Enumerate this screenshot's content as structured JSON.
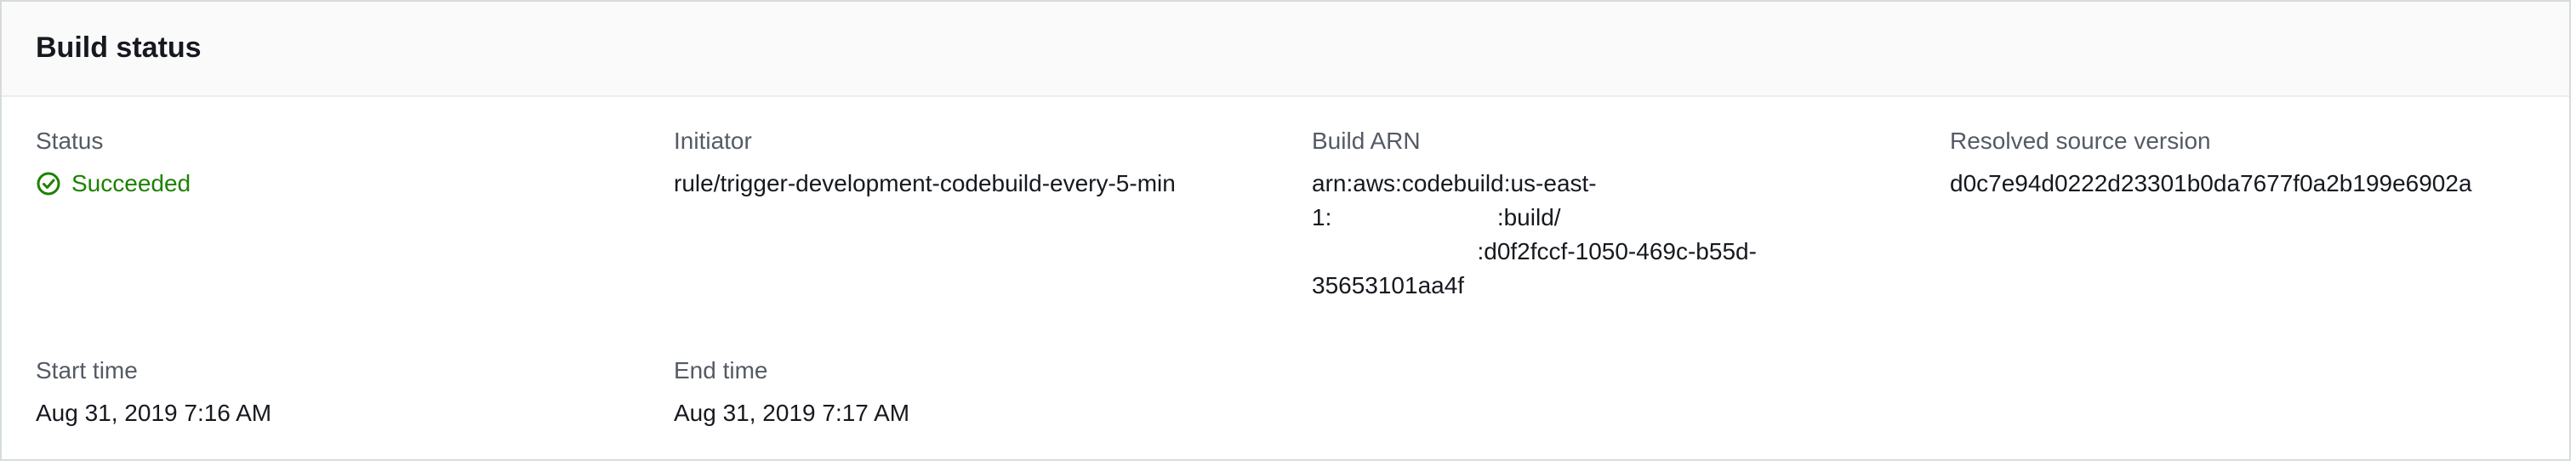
{
  "panel": {
    "title": "Build status"
  },
  "fields": {
    "status": {
      "label": "Status",
      "value": "Succeeded",
      "icon": "check-circle-icon",
      "color": "#1d8102"
    },
    "initiator": {
      "label": "Initiator",
      "value": "rule/trigger-development-codebuild-every-5-min"
    },
    "build_arn": {
      "label": "Build ARN",
      "lines": [
        "arn:aws:codebuild:us-east-",
        "1:                         :build/",
        "                         :d0f2fccf-1050-469c-b55d-",
        "35653101aa4f"
      ]
    },
    "resolved_source_version": {
      "label": "Resolved source version",
      "value": "d0c7e94d0222d23301b0da7677f0a2b199e6902a"
    },
    "start_time": {
      "label": "Start time",
      "value": "Aug 31, 2019 7:16 AM"
    },
    "end_time": {
      "label": "End time",
      "value": "Aug 31, 2019 7:17 AM"
    }
  }
}
